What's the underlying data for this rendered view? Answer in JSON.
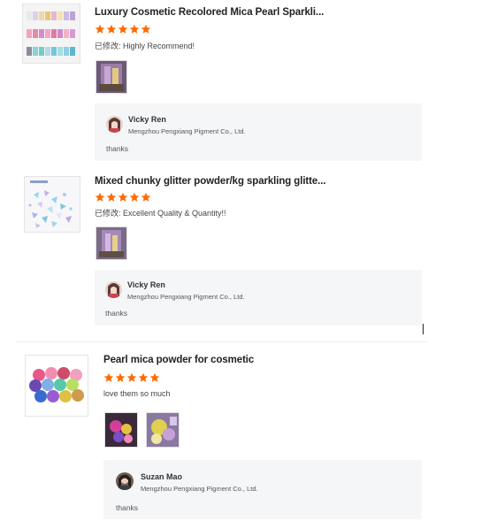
{
  "reviews": [
    {
      "product_title": "Luxury Cosmetic Recolored Mica Pearl Sparkli...",
      "rating": 5,
      "comment": "已修改: Highly Recommend!",
      "photo_count": 1,
      "reply": {
        "name": "Vicky Ren",
        "company": "Mengzhou Pengxiang Pigment Co., Ltd.",
        "text": "thanks"
      }
    },
    {
      "product_title": "Mixed chunky glitter powder/kg sparkling glitte...",
      "rating": 5,
      "comment": "已修改: Excellent Quality & Quantity!!",
      "photo_count": 1,
      "reply": {
        "name": "Vicky Ren",
        "company": "Mengzhou Pengxiang Pigment Co., Ltd.",
        "text": "thanks"
      }
    },
    {
      "product_title": "Pearl mica powder for cosmetic",
      "rating": 5,
      "comment": "love them so much",
      "photo_count": 2,
      "reply": {
        "name": "Suzan Mao",
        "company": "Mengzhou Pengxiang Pigment Co., Ltd.",
        "text": "thanks"
      }
    }
  ],
  "colors": {
    "star": "#ff6a00",
    "reply_bg": "#f5f6f7"
  }
}
